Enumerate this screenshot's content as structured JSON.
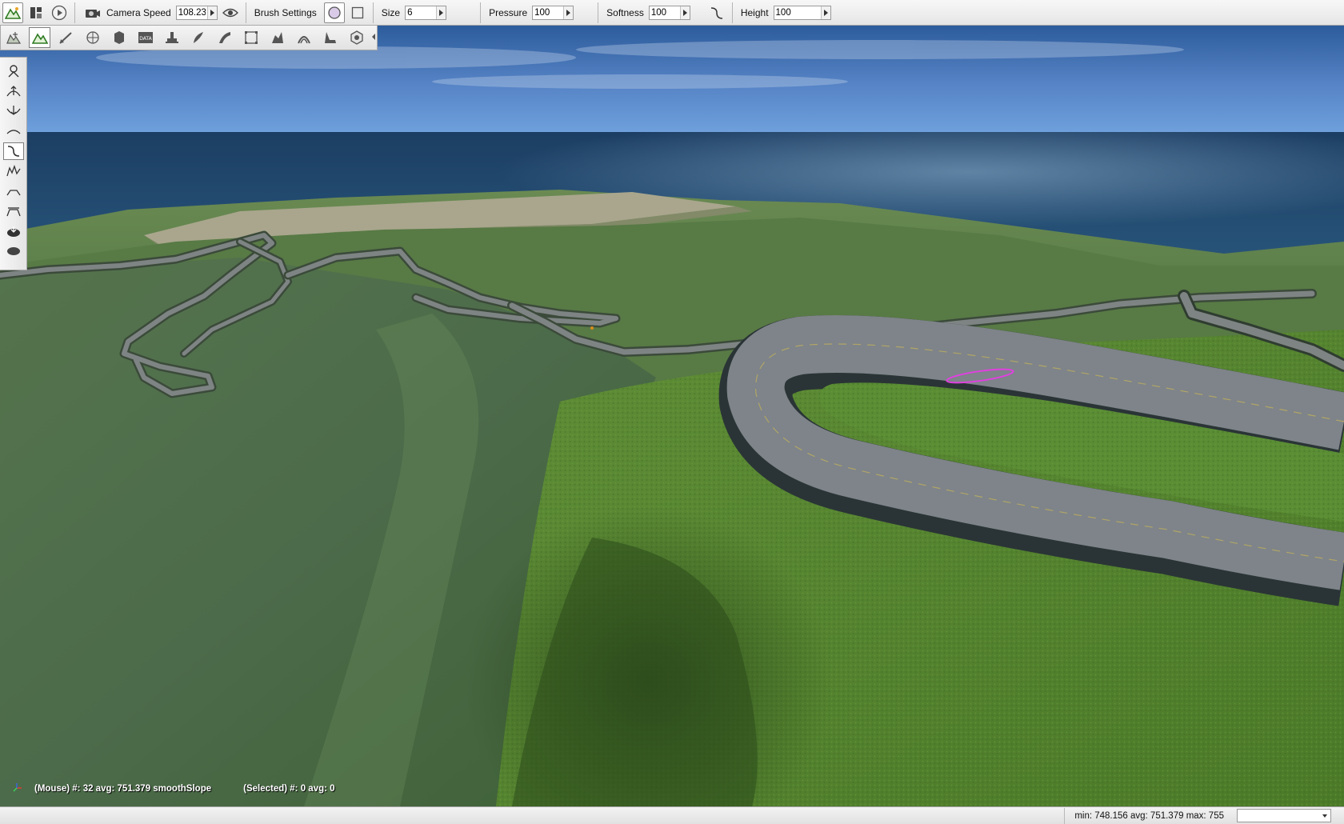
{
  "topbar": {
    "camera_speed_label": "Camera Speed",
    "camera_speed_value": "108.23",
    "brush_settings_label": "Brush Settings",
    "size_label": "Size",
    "size_value": "6",
    "pressure_label": "Pressure",
    "pressure_value": "100",
    "softness_label": "Softness",
    "softness_value": "100",
    "height_label": "Height",
    "height_value": "100",
    "icons": [
      "terrain-editor-icon",
      "window-layout-icon",
      "play-icon",
      "camera-icon",
      "visibility-eye-icon",
      "brush-circle-icon",
      "brush-square-icon",
      "softness-curve-icon"
    ]
  },
  "toolbar2": {
    "tools": [
      "object-editor-icon",
      "terrain-editor-icon",
      "terrain-painter-icon",
      "mission-area-icon",
      "decal-editor-icon",
      "datablock-editor-icon",
      "forest-editor-icon",
      "river-editor-icon",
      "road-editor-icon",
      "mesh-road-editor-icon",
      "navmesh-editor-icon",
      "shape-editor-icon",
      "particle-editor-icon",
      "material-editor-icon"
    ],
    "active_tool": 1
  },
  "lefttools": {
    "tools": [
      "grab-terrain-icon",
      "raise-height-icon",
      "lower-height-icon",
      "smooth-icon",
      "smooth-slope-icon",
      "paint-noise-icon",
      "flatten-icon",
      "set-height-icon",
      "clear-terrain-icon",
      "restore-terrain-icon"
    ],
    "active_tool": 4
  },
  "viewport": {
    "mouse_stats": "(Mouse) #: 32  avg: 751.379 smoothSlope",
    "selected_stats": "(Selected) #: 0  avg: 0"
  },
  "statusbar": {
    "height_stats": "min: 748.156  avg: 751.379  max: 755",
    "selector_value": ""
  },
  "colors": {
    "sky_top": "#2e5fa0",
    "sky_horizon": "#6b9bd8",
    "sea": "#1f4a6e",
    "grass": "#4c7a2c",
    "road": "#7f858a",
    "brush_cursor": "#e040e0"
  }
}
